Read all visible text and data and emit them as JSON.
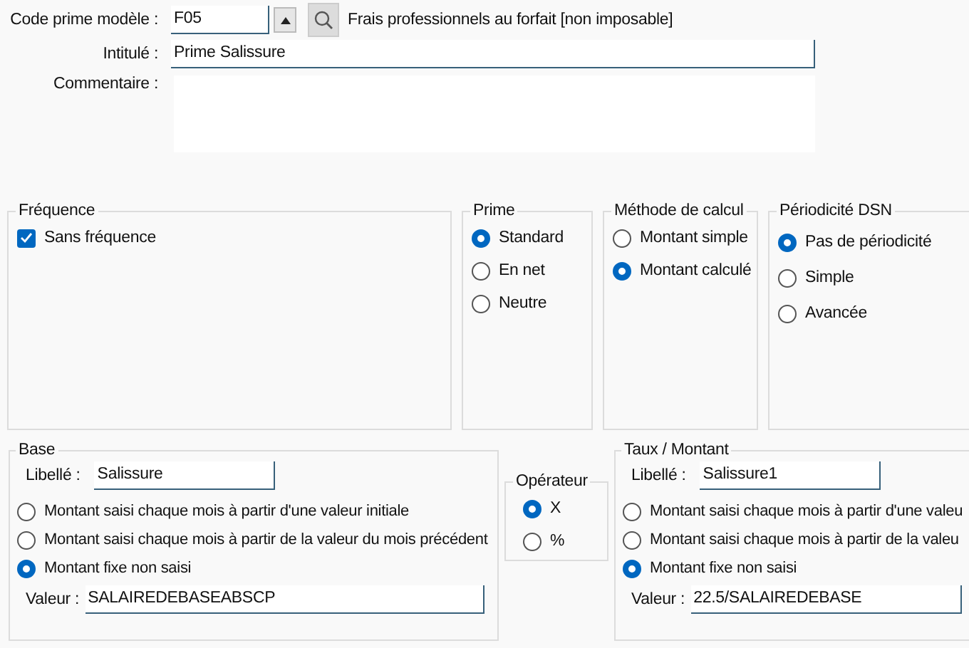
{
  "header": {
    "code_label": "Code prime modèle :",
    "code_value": "F05",
    "code_description": "Frais professionnels au forfait [non imposable]",
    "title_label": "Intitulé :",
    "title_value": "Prime Salissure",
    "comment_label": "Commentaire :"
  },
  "groups": [
    {
      "title": "Fréquence",
      "options": [
        {
          "kind": "checkbox",
          "label": "Sans fréquence",
          "checked": true
        }
      ]
    },
    {
      "title": "Prime",
      "options": [
        {
          "kind": "radio",
          "label": "Standard",
          "selected": true
        },
        {
          "kind": "radio",
          "label": "En net",
          "selected": false
        },
        {
          "kind": "radio",
          "label": "Neutre",
          "selected": false
        }
      ]
    },
    {
      "title": "Méthode de calcul",
      "options": [
        {
          "kind": "radio",
          "label": "Montant simple",
          "selected": false
        },
        {
          "kind": "radio",
          "label": "Montant calculé",
          "selected": true
        }
      ]
    },
    {
      "title": "Périodicité DSN",
      "options": [
        {
          "kind": "radio",
          "label": "Pas de périodicité",
          "selected": true
        },
        {
          "kind": "radio",
          "label": "Simple",
          "selected": false
        },
        {
          "kind": "radio",
          "label": "Avancée",
          "selected": false
        }
      ]
    }
  ],
  "base": {
    "title": "Base",
    "libelle_label": "Libellé :",
    "libelle_value": "Salissure",
    "options": [
      {
        "label": "Montant saisi chaque mois à partir d'une valeur initiale",
        "selected": false
      },
      {
        "label": "Montant saisi chaque mois à partir de la valeur du mois précédent",
        "selected": false
      },
      {
        "label": "Montant fixe non saisi",
        "selected": true
      }
    ],
    "valeur_label": "Valeur :",
    "valeur_value": "SALAIREDEBASEABSCP"
  },
  "operateur": {
    "title": "Opérateur",
    "options": [
      {
        "label": "X",
        "selected": true
      },
      {
        "label": "%",
        "selected": false
      }
    ]
  },
  "taux": {
    "title": "Taux / Montant",
    "libelle_label": "Libellé :",
    "libelle_value": "Salissure1",
    "options": [
      {
        "label": "Montant saisi chaque mois à partir d'une valeu",
        "selected": false
      },
      {
        "label": "Montant saisi chaque mois à partir de la valeu",
        "selected": false
      },
      {
        "label": "Montant fixe non saisi",
        "selected": true
      }
    ],
    "valeur_label": "Valeur :",
    "valeur_value": "22.5/SALAIREDEBASE"
  }
}
